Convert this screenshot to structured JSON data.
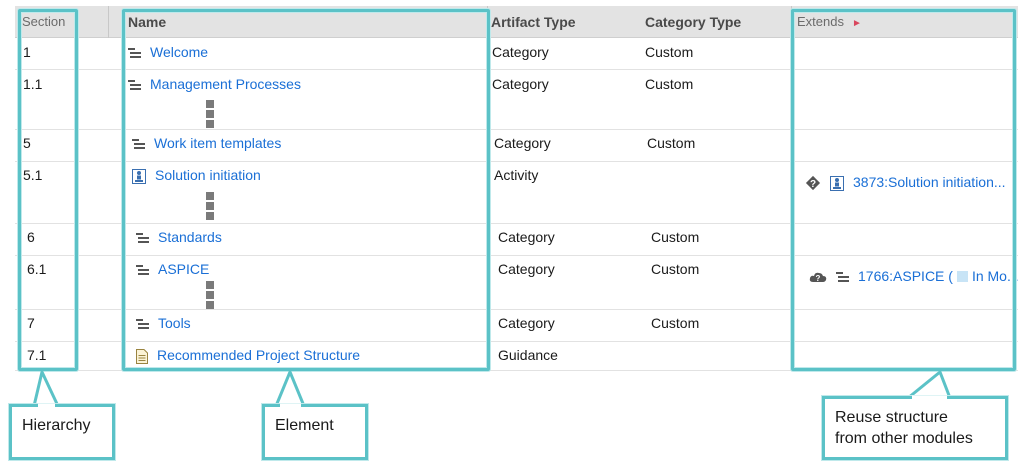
{
  "columns": {
    "section": "Section",
    "name": "Name",
    "artifact_type": "Artifact Type",
    "category_type": "Category Type",
    "extends": "Extends"
  },
  "rows": [
    {
      "section": "1",
      "name": "Welcome",
      "icon": "category-icon",
      "artifact_type": "Category",
      "category_type": "Custom",
      "extends": ""
    },
    {
      "section": "1.1",
      "name": "Management Processes",
      "icon": "category-icon",
      "artifact_type": "Category",
      "category_type": "Custom",
      "extends": ""
    },
    {
      "section": "5",
      "name": "Work item templates",
      "icon": "category-icon",
      "artifact_type": "Category",
      "category_type": "Custom",
      "extends": ""
    },
    {
      "section": "5.1",
      "name": "Solution initiation",
      "icon": "activity-icon",
      "artifact_type": "Activity",
      "category_type": "",
      "extends": "3873:Solution initiation..."
    },
    {
      "section": "6",
      "name": "Standards",
      "icon": "category-icon",
      "artifact_type": "Category",
      "category_type": "Custom",
      "extends": ""
    },
    {
      "section": "6.1",
      "name": "ASPICE",
      "icon": "category-icon",
      "artifact_type": "Category",
      "category_type": "Custom",
      "extends": "1766:ASPICE (",
      "extends_suffix": "In Mo..."
    },
    {
      "section": "7",
      "name": "Tools",
      "icon": "category-icon",
      "artifact_type": "Category",
      "category_type": "Custom",
      "extends": ""
    },
    {
      "section": "7.1",
      "name": "Recommended Project Structure",
      "icon": "guidance-icon",
      "artifact_type": "Guidance",
      "category_type": "",
      "extends": ""
    }
  ],
  "callouts": {
    "hierarchy": "Hierarchy",
    "element": "Element",
    "reuse_line1": "Reuse structure",
    "reuse_line2": "from other modules"
  },
  "colors": {
    "highlight": "#5bc2c7",
    "link": "#1a6fd6",
    "header_bg": "#e3e3e3"
  }
}
